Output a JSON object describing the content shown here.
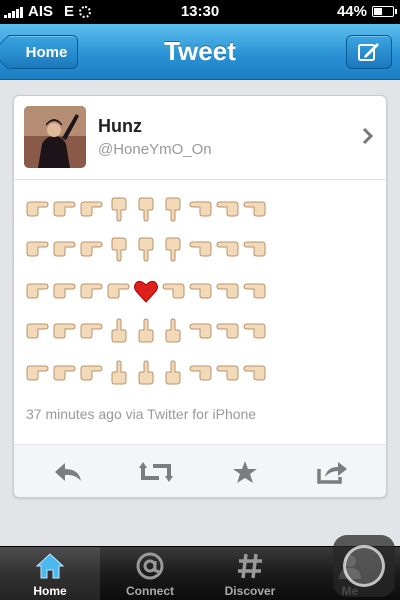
{
  "status_bar": {
    "carrier": "AIS",
    "network": "E",
    "time": "13:30",
    "battery": "44%",
    "battery_level": 0.44
  },
  "nav": {
    "back_label": "Home",
    "title": "Tweet"
  },
  "tweet": {
    "author_name": "Hunz",
    "handle": "@HoneYmO_On",
    "emoji_rows": [
      [
        "point-right",
        "point-right",
        "point-right",
        "point-down",
        "point-down",
        "point-down",
        "point-left",
        "point-left",
        "point-left"
      ],
      [
        "point-right",
        "point-right",
        "point-right",
        "point-down",
        "point-down",
        "point-down",
        "point-left",
        "point-left",
        "point-left"
      ],
      [
        "point-right",
        "point-right",
        "point-right",
        "point-right",
        "heart",
        "point-left",
        "point-left",
        "point-left",
        "point-left"
      ],
      [
        "point-right",
        "point-right",
        "point-right",
        "point-up",
        "point-up",
        "point-up",
        "point-left",
        "point-left",
        "point-left"
      ],
      [
        "point-right",
        "point-right",
        "point-right",
        "point-up",
        "point-up",
        "point-up",
        "point-left",
        "point-left",
        "point-left"
      ]
    ],
    "meta": "37 minutes ago via Twitter for iPhone"
  },
  "actions": [
    "reply-icon",
    "retweet-icon",
    "favorite-icon",
    "share-icon"
  ],
  "tabs": [
    {
      "label": "Home",
      "icon": "home-icon",
      "active": true
    },
    {
      "label": "Connect",
      "icon": "at-icon",
      "active": false
    },
    {
      "label": "Discover",
      "icon": "hash-icon",
      "active": false
    },
    {
      "label": "Me",
      "icon": "person-icon",
      "active": false
    }
  ],
  "colors": {
    "nav_blue": "#2a93d5",
    "heart_red": "#e0201c",
    "hand_skin": "#f2d9b8"
  }
}
